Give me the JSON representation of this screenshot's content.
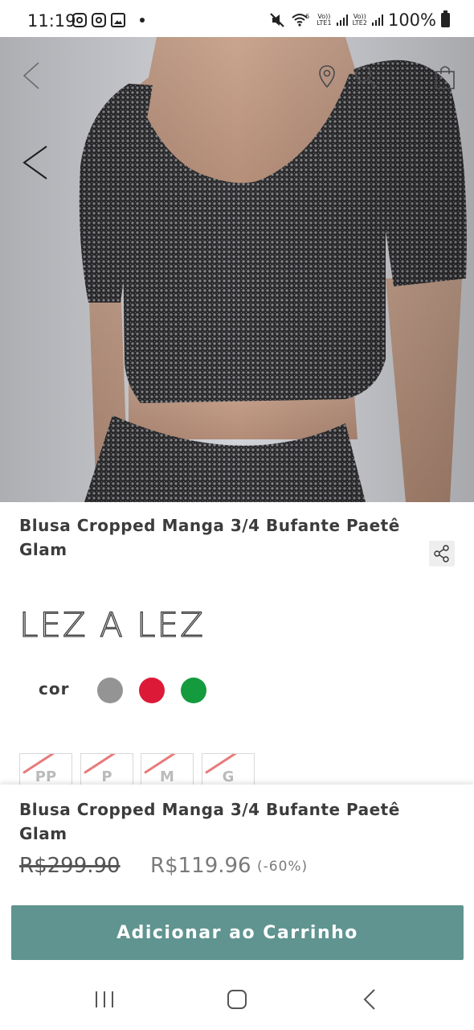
{
  "status_bar": {
    "time": "11:19",
    "left_icons": [
      "instagram-icon",
      "instagram-icon",
      "gallery-icon",
      "dot-icon"
    ],
    "sim1": "LTE1",
    "sim2": "LTE2",
    "volte": "Vo))",
    "wifi_label": "6",
    "battery": "100%"
  },
  "hero": {
    "icons": [
      "back-arrow-icon",
      "location-pin-icon",
      "search-icon",
      "bag-icon",
      "carousel-prev-icon"
    ],
    "background_color": "#d2d3d8"
  },
  "product": {
    "title": "Blusa Cropped Manga 3/4 Bufante Paetê Glam",
    "brand": "LEZ A LEZ",
    "color_label": "cor",
    "colors": [
      {
        "name": "gray",
        "hex": "#949494"
      },
      {
        "name": "red",
        "hex": "#dc1a38"
      },
      {
        "name": "green",
        "hex": "#139b3e"
      }
    ],
    "sizes": [
      {
        "label": "PP",
        "available": false
      },
      {
        "label": "P",
        "available": false
      },
      {
        "label": "M",
        "available": false
      },
      {
        "label": "G",
        "available": false
      }
    ]
  },
  "sticky_bar": {
    "title": "Blusa Cropped Manga 3/4 Bufante Paetê Glam",
    "old_price": "R$299.90",
    "new_price": "R$119.96",
    "discount": "(-60%)",
    "add_to_cart_label": "Adicionar ao Carrinho",
    "button_color": "#5f9490"
  },
  "nav_bar": {
    "items": [
      "recents-icon",
      "home-icon",
      "back-icon"
    ]
  }
}
